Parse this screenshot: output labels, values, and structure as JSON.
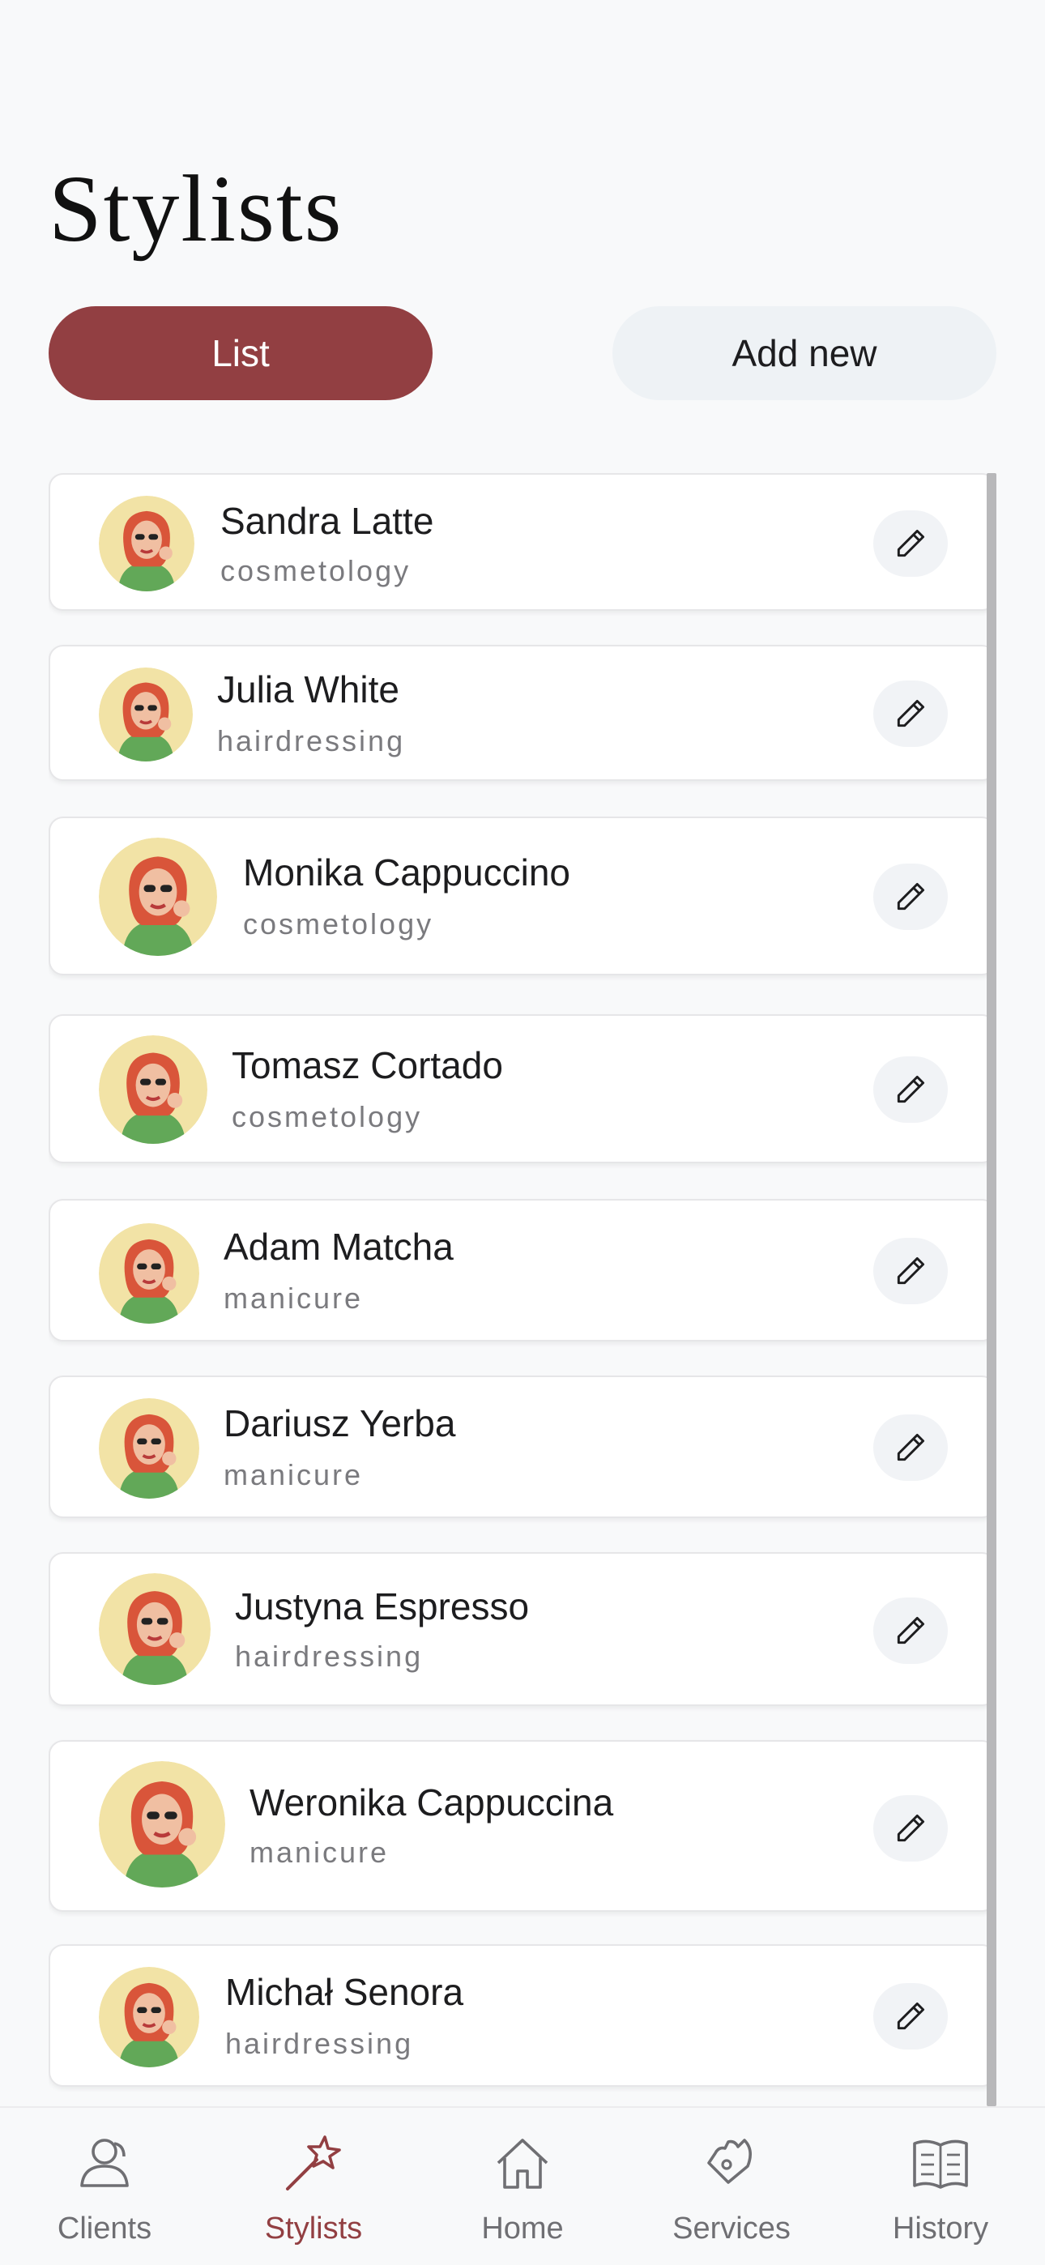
{
  "header": {
    "title": "Stylists"
  },
  "segments": {
    "list_label": "List",
    "add_label": "Add new",
    "active": "List"
  },
  "stylists": [
    {
      "name": "Sandra Latte",
      "specialty": "cosmetology"
    },
    {
      "name": "Julia White",
      "specialty": "hairdressing"
    },
    {
      "name": "Monika Cappuccino",
      "specialty": "cosmetology"
    },
    {
      "name": "Tomasz Cortado",
      "specialty": "cosmetology"
    },
    {
      "name": "Adam Matcha",
      "specialty": "manicure"
    },
    {
      "name": "Dariusz Yerba",
      "specialty": "manicure"
    },
    {
      "name": "Justyna Espresso",
      "specialty": "hairdressing"
    },
    {
      "name": "Weronika Cappuccina",
      "specialty": "manicure"
    },
    {
      "name": "Michał Senora",
      "specialty": "hairdressing"
    }
  ],
  "tabs": [
    {
      "label": "Clients",
      "icon": "clients-icon"
    },
    {
      "label": "Stylists",
      "icon": "stylists-icon"
    },
    {
      "label": "Home",
      "icon": "home-icon"
    },
    {
      "label": "Services",
      "icon": "services-icon"
    },
    {
      "label": "History",
      "icon": "history-icon"
    }
  ],
  "active_tab": "Stylists",
  "colors": {
    "accent": "#923f42",
    "background": "#f8f9fa",
    "secondary_button": "#eef2f5"
  }
}
